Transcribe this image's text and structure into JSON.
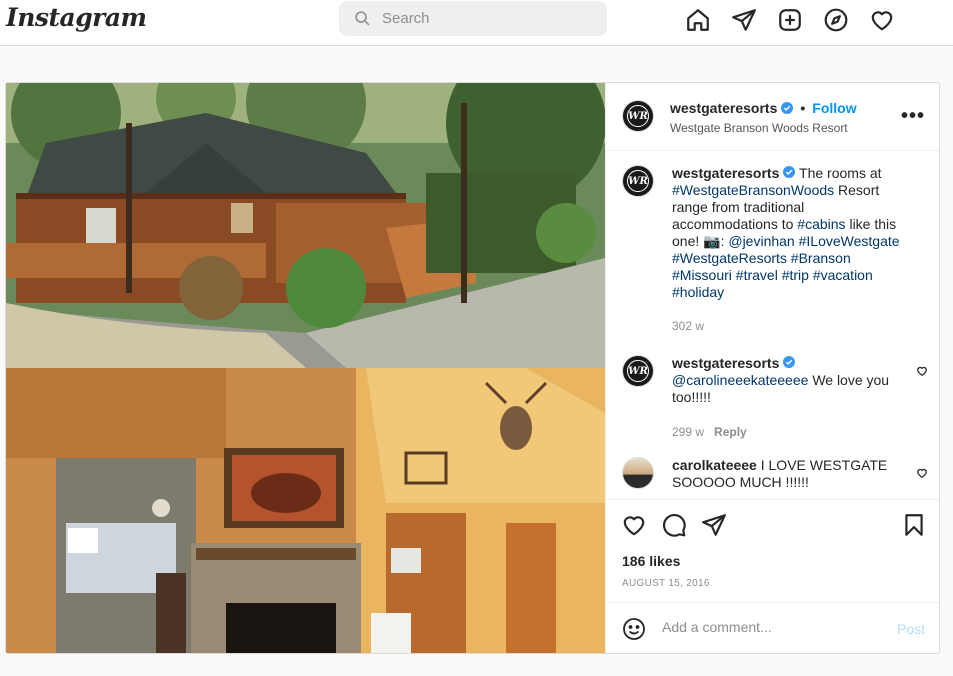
{
  "header": {
    "logo": "Instagram",
    "search_placeholder": "Search",
    "nav_icons": [
      "home-icon",
      "direct-message-icon",
      "new-post-icon",
      "explore-icon",
      "activity-heart-icon"
    ]
  },
  "post": {
    "author": {
      "username": "westgateresorts",
      "avatar_text": "WR",
      "verified": true,
      "follow_label": "Follow",
      "location": "Westgate Branson Woods Resort"
    },
    "more_label": "•••",
    "caption": {
      "username": "westgateresorts",
      "text_1": "The rooms at",
      "tag_1": "#WestgateBransonWoods",
      "text_2": "Resort range from traditional accommodations to",
      "tag_2": "#cabins",
      "text_3": "like this one! 📷:",
      "mention": "@jevinhan",
      "tags_tail": "#ILoveWestgate #WestgateResorts #Branson #Missouri #travel #trip #vacation #holiday",
      "age": "302 w"
    },
    "comments": [
      {
        "username": "westgateresorts",
        "mention": "@carolineeekateeeee",
        "text": "We love you too!!!!!",
        "age": "299 w",
        "reply_label": "Reply"
      },
      {
        "username": "carolkateeee",
        "text": "I LOVE WESTGATE SOOOOO MUCH !!!!!!"
      }
    ],
    "likes": "186 likes",
    "date": "AUGUST 15, 2016",
    "comment_placeholder": "Add a comment...",
    "post_label": "Post"
  },
  "colors": {
    "accent": "#0095f6",
    "hashtag": "#00376b",
    "verified": "#3897f0",
    "muted": "#8e8e8e"
  }
}
